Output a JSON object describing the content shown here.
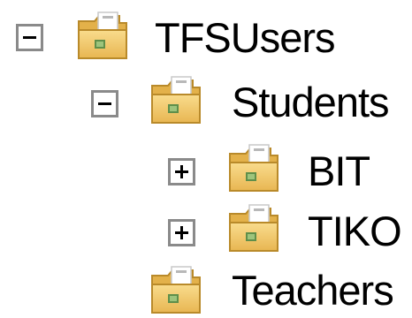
{
  "tree": {
    "nodes": [
      {
        "label": "TFSUsers",
        "state": "expanded"
      },
      {
        "label": "Students",
        "state": "expanded"
      },
      {
        "label": "BIT",
        "state": "collapsed"
      },
      {
        "label": "TIKO",
        "state": "collapsed"
      },
      {
        "label": "Teachers",
        "state": "leaf"
      }
    ]
  },
  "colors": {
    "toggle_border": "#8a8a8a",
    "folder_body": "#f2c96a",
    "folder_tab": "#e3b14a"
  },
  "icons": {
    "expanded": "minus-icon",
    "collapsed": "plus-icon",
    "node": "folder-icon"
  }
}
